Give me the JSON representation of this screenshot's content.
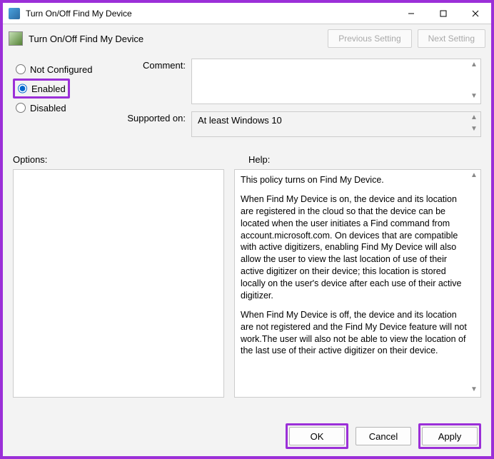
{
  "titlebar": {
    "title": "Turn On/Off Find My Device"
  },
  "toolbar": {
    "label": "Turn On/Off Find My Device",
    "prev": "Previous Setting",
    "next": "Next Setting"
  },
  "radios": {
    "not_configured": "Not Configured",
    "enabled": "Enabled",
    "disabled": "Disabled",
    "selected": "enabled"
  },
  "fields": {
    "comment_label": "Comment:",
    "comment_value": "",
    "supported_label": "Supported on:",
    "supported_value": "At least Windows 10"
  },
  "panels": {
    "options_label": "Options:",
    "help_label": "Help:"
  },
  "help_text": {
    "p1": "This policy turns on Find My Device.",
    "p2": "When Find My Device is on, the device and its location are registered in the cloud so that the device can be located when the user initiates a Find command from account.microsoft.com. On devices that are compatible with active digitizers, enabling Find My Device will also allow the user to view the last location of use of their active digitizer on their device; this location is stored locally on the user's device after each use of their active digitizer.",
    "p3": "When Find My Device is off, the device and its location are not registered and the Find My Device feature will not work.The user will also not be able to view the location of the last use of their active digitizer on their device."
  },
  "footer": {
    "ok": "OK",
    "cancel": "Cancel",
    "apply": "Apply"
  }
}
